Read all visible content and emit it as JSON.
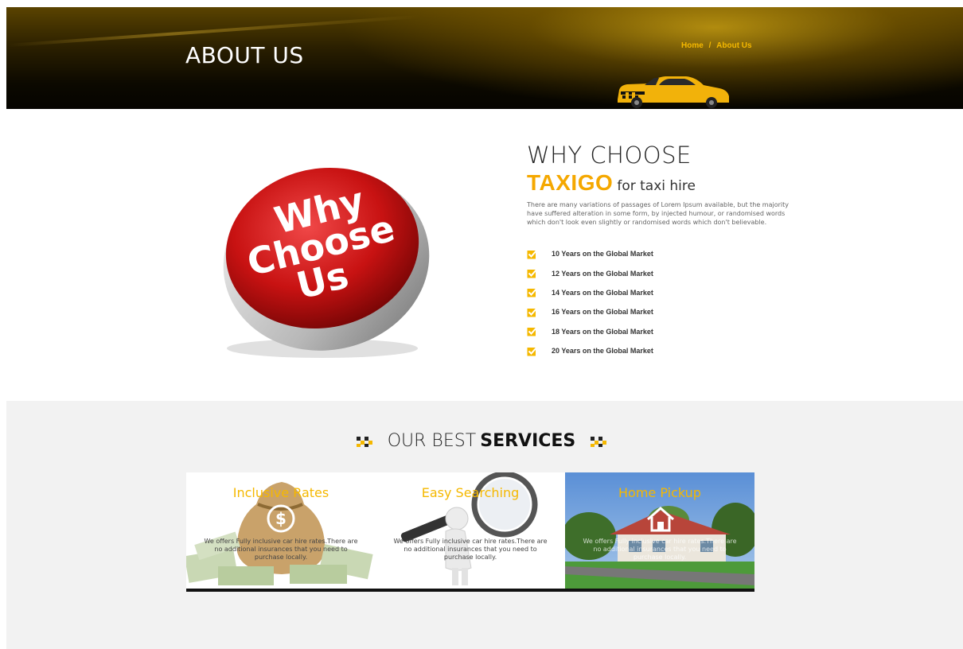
{
  "hero": {
    "title": "ABOUT US",
    "breadcrumb": {
      "home": "Home",
      "separator": "/",
      "current": "About Us"
    }
  },
  "why": {
    "badge_text": [
      "Why",
      "Choose",
      "Us"
    ],
    "title": "WHY CHOOSE",
    "brand": "TAXIGO",
    "subtitle": "for taxi hire",
    "description": "There are many variations of passages of Lorem Ipsum available, but the majority have suffered alteration in some form, by injected humour, or randomised words which don't look even slightly or randomised words which don't believable.",
    "features": [
      "10 Years on the Global Market",
      "12 Years on the Global Market",
      "14 Years on the Global Market",
      "16 Years on the Global Market",
      "18 Years on the Global Market",
      "20 Years on the Global Market"
    ]
  },
  "services": {
    "title_light": "OUR BEST",
    "title_bold": "SERVICES",
    "cards": [
      {
        "title": "Inclusive Rates",
        "desc": "We offers Fully inclusive car hire rates.There are no additional insurances that you need to purchase locally."
      },
      {
        "title": "Easy Searching",
        "desc": "We offers Fully inclusive car hire rates.There are no additional insurances that you need to purchase locally."
      },
      {
        "title": "Home Pickup",
        "desc": "We offers Fully inclusive car hire rates.There are no additional insurances that you need to purchase locally."
      }
    ]
  },
  "colors": {
    "accent": "#f5b800",
    "brand": "#f5a800",
    "badge_red": "#d01818"
  },
  "icons": [
    "checkbox-icon",
    "checker-flag-icon",
    "dollar-icon",
    "home-icon",
    "taxi-car"
  ]
}
